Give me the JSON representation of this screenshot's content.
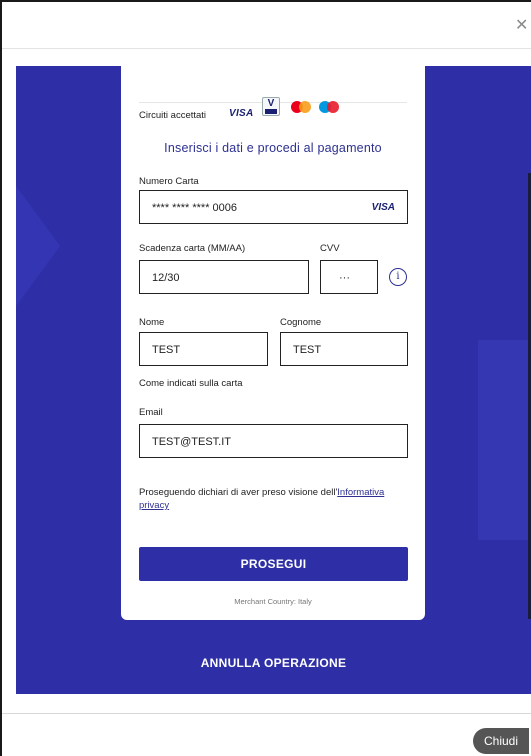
{
  "window": {
    "close_icon": "close-icon",
    "chiudi_label": "Chiudi"
  },
  "card": {
    "circuits_label": "Circuiti accettati",
    "logos": [
      "VISA",
      "V PAY",
      "mastercard",
      "maestro"
    ],
    "visa_text": "VISA",
    "vpay_text": "V",
    "heading": "Inserisci i dati e procedi al pagamento",
    "card_number": {
      "label": "Numero Carta",
      "value": "**** **** **** 0006",
      "brand": "VISA"
    },
    "expiry": {
      "label": "Scadenza carta (MM/AA)",
      "value": "12/30"
    },
    "cvv": {
      "label": "CVV",
      "value": "···",
      "info_icon": "info-icon",
      "info_glyph": "i"
    },
    "first_name": {
      "label": "Nome",
      "value": "TEST"
    },
    "last_name": {
      "label": "Cognome",
      "value": "TEST"
    },
    "name_hint": "Come indicati sulla carta",
    "email": {
      "label": "Email",
      "value": "TEST@TEST.IT"
    },
    "privacy_text": "Proseguendo dichiari di aver preso visione dell'",
    "privacy_link": "Informativa privacy",
    "submit_label": "PROSEGUI",
    "merchant": "Merchant Country: Italy"
  },
  "cancel_label": "ANNULLA OPERAZIONE",
  "colors": {
    "primary": "#2e2fa6",
    "link": "#2e3192",
    "chiudi_bg": "#555555"
  }
}
